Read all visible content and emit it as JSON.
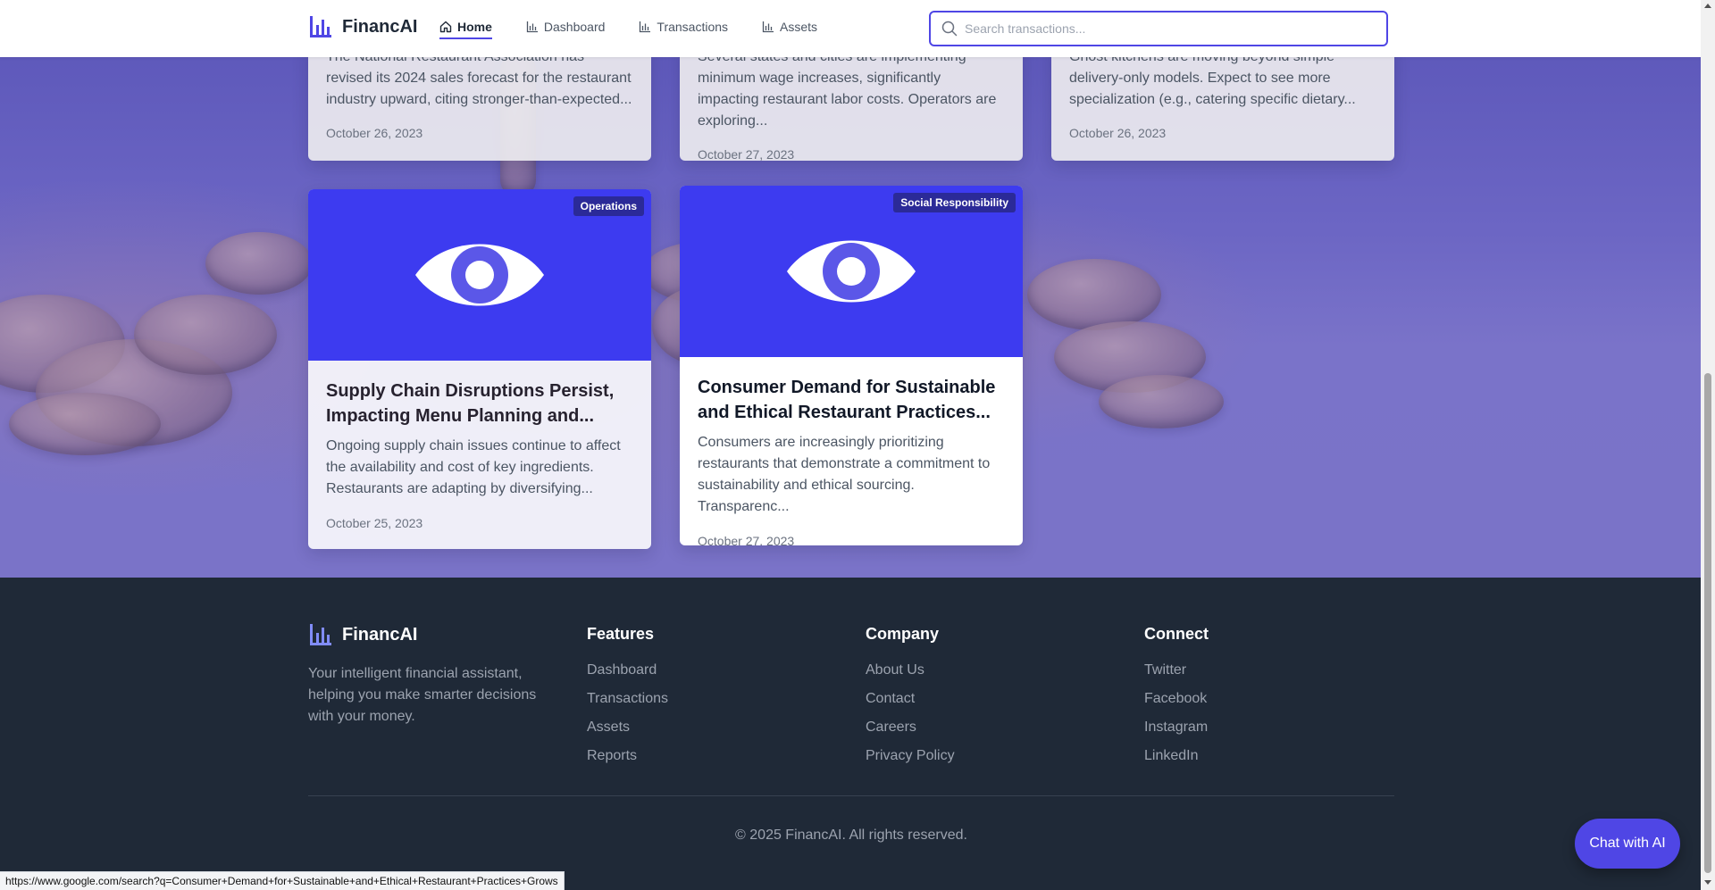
{
  "header": {
    "brand": "FinancAI",
    "nav": [
      {
        "label": "Home",
        "icon": "home-icon",
        "active": true
      },
      {
        "label": "Dashboard",
        "icon": "bar-chart-icon",
        "active": false
      },
      {
        "label": "Transactions",
        "icon": "bar-chart-icon",
        "active": false
      },
      {
        "label": "Assets",
        "icon": "bar-chart-icon",
        "active": false
      }
    ],
    "search": {
      "placeholder": "Search transactions...",
      "value": ""
    }
  },
  "articles_top": [
    {
      "desc_partial": "The National Restaurant Association has revised its 2024 sales forecast for the restaurant industry upward, citing stronger-than-expected...",
      "date": "October 26, 2023"
    },
    {
      "desc_partial": "Several states and cities are implementing minimum wage increases, significantly impacting restaurant labor costs. Operators are exploring...",
      "date": "October 27, 2023"
    },
    {
      "desc_partial": "Ghost kitchens are moving beyond simple delivery-only models. Expect to see more specialization (e.g., catering specific dietary...",
      "date": "October 26, 2023"
    }
  ],
  "articles": [
    {
      "tag": "Operations",
      "title": "Supply Chain Disruptions Persist, Impacting Menu Planning and...",
      "desc": "Ongoing supply chain issues continue to affect the availability and cost of key ingredients. Restaurants are adapting by diversifying...",
      "date": "October 25, 2023",
      "icon": "eye-icon"
    },
    {
      "tag": "Social Responsibility",
      "title": "Consumer Demand for Sustainable and Ethical Restaurant Practices...",
      "desc": "Consumers are increasingly prioritizing restaurants that demonstrate a commitment to sustainability and ethical sourcing. Transparenc...",
      "date": "October 27, 2023",
      "icon": "eye-icon"
    }
  ],
  "footer": {
    "brand": "FinancAI",
    "tagline": "Your intelligent financial assistant, helping you make smarter decisions with your money.",
    "columns": [
      {
        "title": "Features",
        "links": [
          "Dashboard",
          "Transactions",
          "Assets",
          "Reports"
        ]
      },
      {
        "title": "Company",
        "links": [
          "About Us",
          "Contact",
          "Careers",
          "Privacy Policy"
        ]
      },
      {
        "title": "Connect",
        "links": [
          "Twitter",
          "Facebook",
          "Instagram",
          "LinkedIn"
        ]
      }
    ],
    "copyright": "© 2025 FinancAI. All rights reserved."
  },
  "chat_button": "Chat with AI",
  "status_url": "https://www.google.com/search?q=Consumer+Demand+for+Sustainable+and+Ethical+Restaurant+Practices+Grows",
  "colors": {
    "accent": "#4f46e5",
    "card_media": "#3d3bf0",
    "footer_bg": "#1f2937"
  }
}
